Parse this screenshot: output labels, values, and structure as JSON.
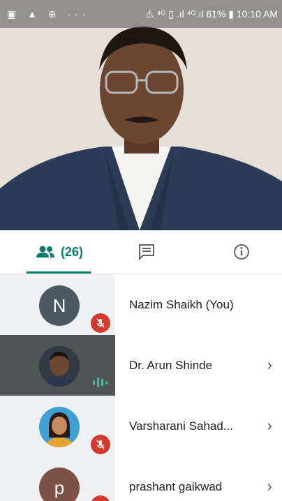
{
  "status_bar": {
    "left_icons": "▣ ▲ ⊕ ···",
    "right_text": "⚠ ⁴ᴳ ▯ .ıl ⁴ᴳ.ıl 61% ▮ 10:10 AM"
  },
  "tabs": {
    "people_count": "(26)"
  },
  "participants": [
    {
      "name": "Nazim Shaikh (You)",
      "initial": "N",
      "muted": true
    },
    {
      "name": "Dr. Arun Shinde",
      "initial": "",
      "speaking": true
    },
    {
      "name": "Varsharani Sahad...",
      "initial": "",
      "muted": true
    },
    {
      "name": "prashant gaikwad",
      "initial": "p",
      "muted": true
    }
  ],
  "colors": {
    "accent": "#0b7c6a",
    "mute_red": "#d33a2f"
  }
}
